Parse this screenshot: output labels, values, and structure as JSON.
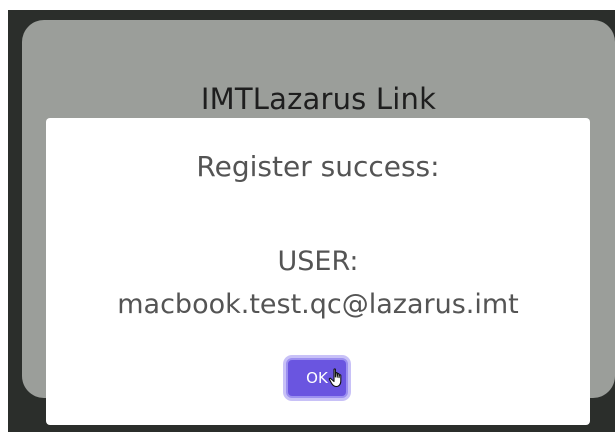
{
  "background": {
    "title": "IMTLazarus Link"
  },
  "dialog": {
    "message": "Register success:",
    "user_label": "USER:",
    "user_email": "macbook.test.qc@lazarus.imt",
    "ok_label": "OK"
  },
  "colors": {
    "backdrop": "#2b2e2b",
    "card": "#9b9e9a",
    "dialog_bg": "#ffffff",
    "text": "#545454",
    "button": "#6a55e0"
  },
  "icons": {
    "cursor": "hand-pointer-icon"
  }
}
